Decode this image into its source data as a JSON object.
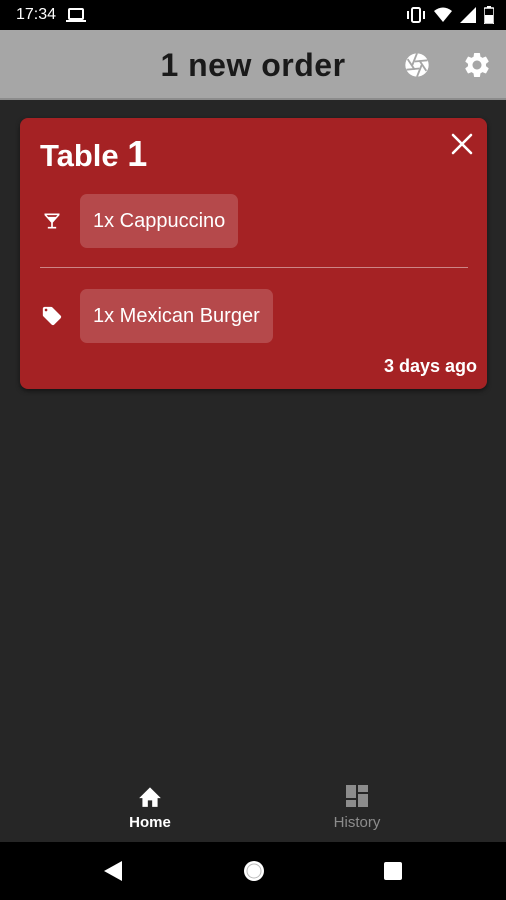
{
  "status_bar": {
    "time": "17:34",
    "icons": [
      "laptop-icon",
      "vibrate-icon",
      "wifi-icon",
      "signal-icon",
      "battery-icon"
    ]
  },
  "app_bar": {
    "title": "1 new order",
    "actions": [
      "aperture-icon",
      "settings-icon"
    ]
  },
  "order": {
    "title_word": "Table",
    "table_number": "1",
    "items": [
      {
        "icon": "cocktail-icon",
        "label": "1x Cappuccino"
      },
      {
        "icon": "tag-icon",
        "label": "1x Mexican Burger"
      }
    ],
    "time_ago": "3 days ago"
  },
  "bottom_nav": {
    "items": [
      {
        "icon": "home-icon",
        "label": "Home",
        "active": true
      },
      {
        "icon": "history-icon",
        "label": "History",
        "active": false
      }
    ]
  },
  "colors": {
    "background": "#262626",
    "app_bar": "#a6a6a6",
    "card": "#a52224",
    "active_nav": "#ffffff",
    "inactive_nav": "#8c8c8c"
  }
}
